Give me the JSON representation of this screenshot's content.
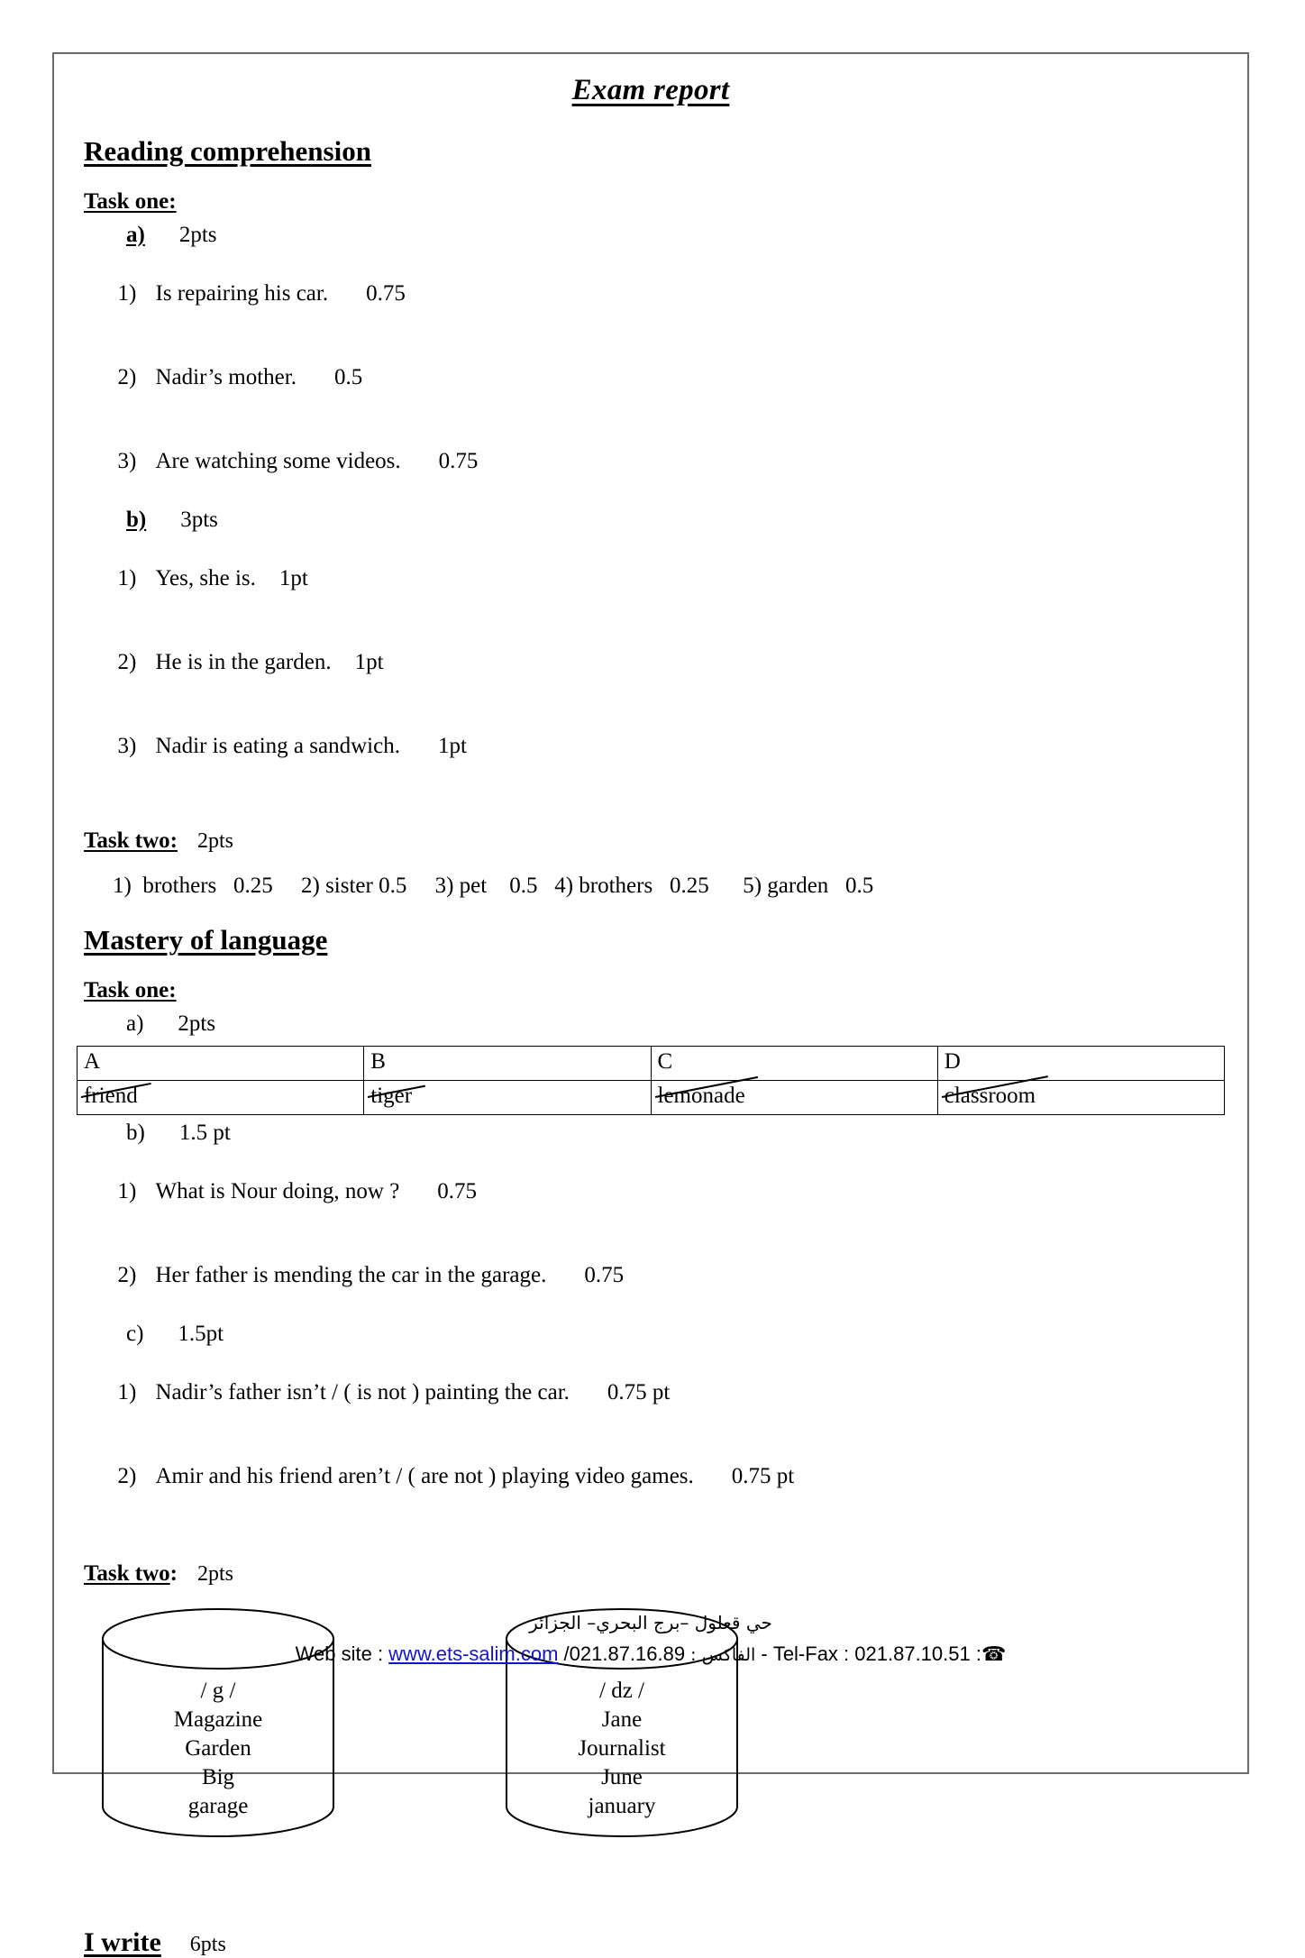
{
  "document": {
    "title": "Exam report"
  },
  "sections": [
    {
      "heading": "Reading comprehension",
      "task_one": {
        "label": "Task one:",
        "part_a": {
          "label": "a)",
          "points": "2pts"
        },
        "part_a_items": [
          {
            "num": "1)",
            "text": "Is repairing his car.",
            "score": "0.75"
          },
          {
            "num": "2)",
            "text": "Nadir’s mother.",
            "score": "0.5"
          },
          {
            "num": "3)",
            "text": "Are watching some videos.",
            "score": "0.75"
          }
        ],
        "part_b": {
          "label": "b)",
          "points": "3pts"
        },
        "part_b_items": [
          {
            "num": "1)",
            "text": "Yes, she is.",
            "score": "1pt"
          },
          {
            "num": "2)",
            "text": "He is in the garden.",
            "score": "1pt"
          },
          {
            "num": "3)",
            "text": "Nadir is eating a sandwich.",
            "score": "1pt"
          }
        ]
      },
      "task_two": {
        "label": "Task two:",
        "points": "2pts",
        "answers_line": "1)  brothers   0.25     2) sister 0.5     3) pet    0.5   4) brothers   0.25      5) garden   0.5"
      }
    },
    {
      "heading": "Mastery of language",
      "task_one": {
        "label": "Task one:",
        "part_a": {
          "label": "a)",
          "points": "2pts"
        },
        "table": {
          "headers": [
            "A",
            "B",
            "C",
            "D"
          ],
          "values": [
            "friend",
            "tiger",
            "lemonade",
            "classroom"
          ]
        },
        "part_b": {
          "label": "b)",
          "points": "1.5 pt"
        },
        "part_b_items": [
          {
            "num": "1)",
            "text": "What is Nour doing, now ?",
            "score": "0.75"
          },
          {
            "num": "2)",
            "text": "Her father is mending the car in the garage.",
            "score": "0.75"
          }
        ],
        "part_c": {
          "label": "c)",
          "points": "1.5pt"
        },
        "part_c_items": [
          {
            "num": "1)",
            "text": "Nadir’s father isn’t / ( is not ) painting the car.",
            "score": "0.75 pt"
          },
          {
            "num": "2)",
            "text": "Amir and his friend aren’t / ( are not ) playing video games.",
            "score": "0.75 pt"
          }
        ]
      },
      "task_two": {
        "label": "Task two",
        "colon": ":",
        "points": "2pts",
        "cylinders": [
          {
            "phoneme": "/ g /",
            "words": [
              "Magazine",
              "Garden",
              "Big",
              "garage"
            ]
          },
          {
            "phoneme": "/ dz /",
            "words": [
              "Jane",
              "Journalist",
              "June",
              "january"
            ]
          }
        ]
      }
    }
  ],
  "write_section": {
    "label": "I write",
    "points": "6pts"
  },
  "footer": {
    "address_arabic": "حي قعلول –برج البحري– الجزائر",
    "website_label": "Web site : ",
    "website_url": "www.ets-salim.com",
    "fax_number": " /021.87.16.89",
    "fax_label_arabic": " الفاكس : ",
    "telfax_label": "- Tel-Fax : 021.87.10.51 :",
    "phone_icon": "☎"
  }
}
